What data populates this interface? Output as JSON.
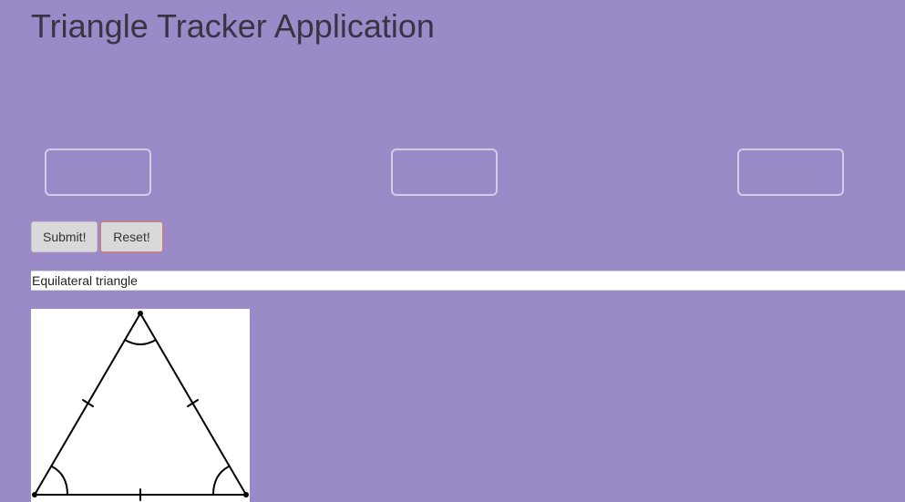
{
  "header": {
    "title": "Triangle Tracker Application"
  },
  "form": {
    "side_a": {
      "value": "",
      "placeholder": ""
    },
    "side_b": {
      "value": "",
      "placeholder": ""
    },
    "side_c": {
      "value": "",
      "placeholder": ""
    },
    "submit_label": "Submit!",
    "reset_label": "Reset!"
  },
  "result": {
    "text": "Equilateral triangle"
  },
  "figure": {
    "icon": "equilateral-triangle-icon",
    "stroke_color": "#000000",
    "background_color": "#ffffff"
  },
  "colors": {
    "page_background": "#9a8bc8",
    "title_text": "#3a3344",
    "reset_border": "#e0785a"
  }
}
